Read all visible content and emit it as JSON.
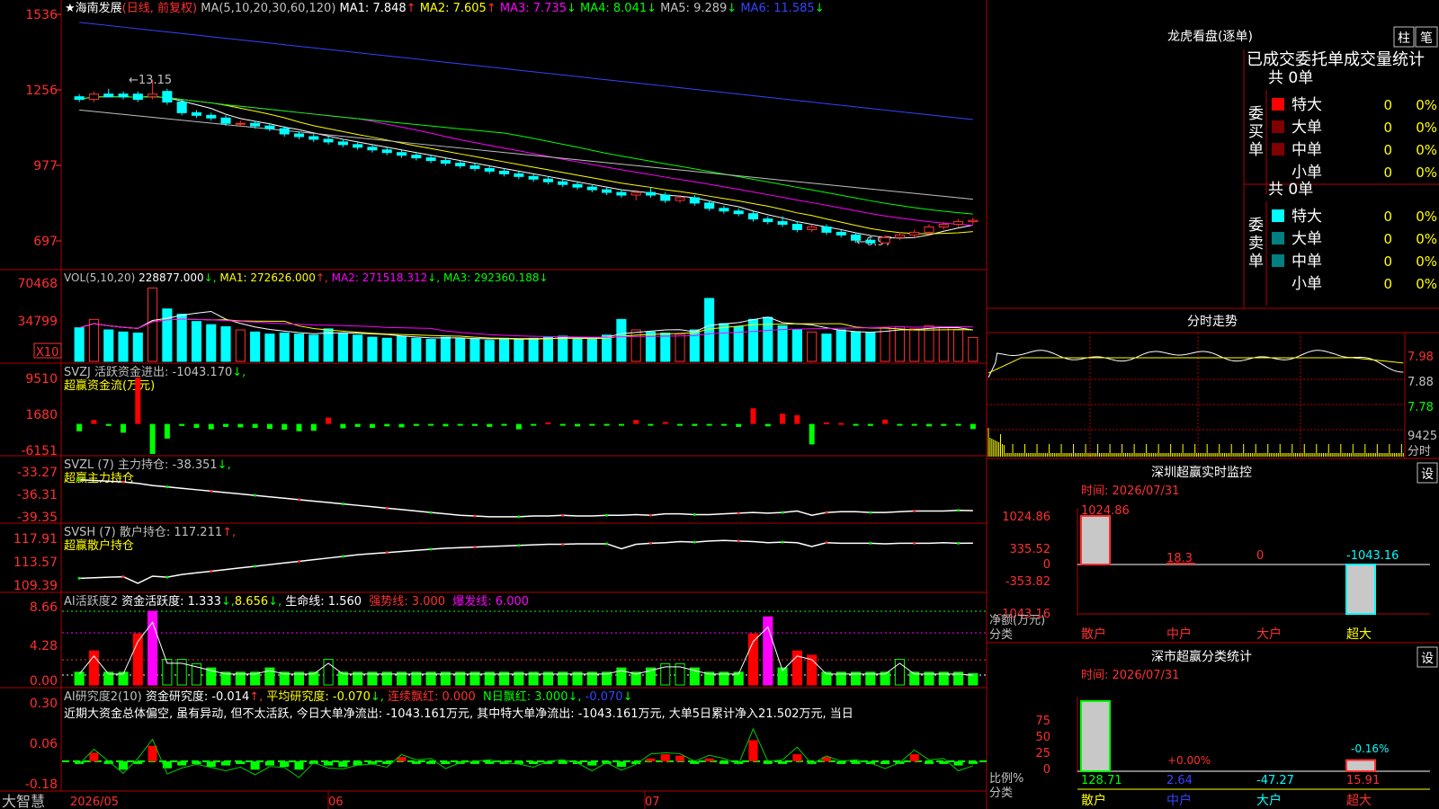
{
  "stock": {
    "name": "海南发展",
    "mode": "(日线, 前复权)",
    "ma_spec": "MA(5,10,20,30,60,120)",
    "ma": [
      {
        "label": "MA1: 7.848",
        "arrow": "↑",
        "color": "#ffffff"
      },
      {
        "label": "MA2: 7.605",
        "arrow": "↑",
        "color": "#ffff00"
      },
      {
        "label": "MA3: 7.735",
        "arrow": "↓",
        "color": "#ff00ff"
      },
      {
        "label": "MA4: 8.041",
        "arrow": "↓",
        "color": "#00ff00"
      },
      {
        "label": "MA5: 9.289",
        "arrow": "↓",
        "color": "#c0c0c0"
      },
      {
        "label": "MA6: 11.585",
        "arrow": "↓",
        "color": "#3344ff"
      }
    ],
    "price_axis": [
      "1536",
      "1256",
      "977",
      "697"
    ],
    "high_label": "13.15",
    "low_label": "6.97"
  },
  "vol": {
    "spec": "VOL(5,10,20)",
    "value": "228877.000",
    "ma1": "MA1: 272626.000",
    "ma2": "MA2: 271518.312",
    "ma3": "MA3: 292360.188",
    "axis": [
      "70468",
      "34799"
    ],
    "unit": "X10"
  },
  "svzj": {
    "line1": "SVZJ  活跃资金进出: -1043.170",
    "line2": "超赢资金流(万元)",
    "axis": [
      "9510",
      "1680",
      "-6151"
    ]
  },
  "svzl": {
    "line1": "SVZL (7) 主力持仓: -38.351",
    "line2": "超赢主力持仓",
    "axis": [
      "-33.27",
      "-36.31",
      "-39.35"
    ]
  },
  "svsh": {
    "line1": "SVSH (7) 散户持仓: 117.211",
    "line2": "超赢散户持仓",
    "axis": [
      "117.91",
      "113.57",
      "109.39"
    ]
  },
  "ai_active": {
    "title": "AI活跃度2",
    "v1": "资金活跃度: 1.333",
    "v2": "8.656",
    "v3": "生命线: 1.560",
    "v4": "强势线: 3.000",
    "v5": "爆发线: 6.000",
    "axis": [
      "8.66",
      "4.28",
      "0.00"
    ]
  },
  "ai_research": {
    "title": "AI研究度2(10)",
    "v1": "资金研究度: -0.014",
    "v2": "平均研究度: -0.070",
    "v3": "连续飘红: 0.000",
    "v4": "N日飘红: 3.000",
    "v5": "-0.070",
    "summary": "近期大资金总体偏空, 虽有异动, 但不太活跃, 今日大单净流出: -1043.161万元, 其中特大单净流出: -1043.161万元, 大单5日累计净入21.502万元, 当日",
    "axis": [
      "0.30",
      "0.06",
      "-0.18"
    ]
  },
  "bottom": {
    "brand": "大智慧",
    "dates": [
      "2026/05",
      "06",
      "07"
    ]
  },
  "lhkp": {
    "title": "龙虎看盘(逐单)",
    "btn_zhu": "柱",
    "btn_bi": "笔",
    "header": "已成交委托单成交量统计",
    "buy_label": "委买单",
    "sell_label": "委卖单",
    "buy_total": "共 0单",
    "sell_total": "共 0单",
    "buy_rows": [
      {
        "name": "特大",
        "count": "0",
        "pct": "0%",
        "color": "#ff0000"
      },
      {
        "name": "大单",
        "count": "0",
        "pct": "0%",
        "color": "#800000"
      },
      {
        "name": "中单",
        "count": "0",
        "pct": "0%",
        "color": "#800000"
      },
      {
        "name": "小单",
        "count": "0",
        "pct": "0%",
        "color": ""
      }
    ],
    "sell_rows": [
      {
        "name": "特大",
        "count": "0",
        "pct": "0%",
        "color": "#00ffff"
      },
      {
        "name": "大单",
        "count": "0",
        "pct": "0%",
        "color": "#008080"
      },
      {
        "name": "中单",
        "count": "0",
        "pct": "0%",
        "color": "#008080"
      },
      {
        "name": "小单",
        "count": "0",
        "pct": "0%",
        "color": ""
      }
    ]
  },
  "intraday": {
    "title": "分时走势",
    "axis": [
      "7.98",
      "7.88",
      "7.78"
    ],
    "vol_label": "9425",
    "unit": "分时"
  },
  "sz_monitor": {
    "title": "深圳超赢实时监控",
    "btn": "设",
    "time": "时间: 2026/07/31",
    "axis": [
      "1024.86",
      "335.52",
      "0",
      "-353.82",
      "-1043.16"
    ],
    "values": [
      "1024.86",
      "18.3",
      "0",
      "-1043.16"
    ],
    "ylabel1": "净额(万元)",
    "ylabel2": "分类",
    "categories": [
      "散户",
      "中户",
      "大户",
      "超大"
    ]
  },
  "sz_class": {
    "title": "深市超赢分类统计",
    "btn": "设",
    "time": "时间: 2026/07/31",
    "axis": [
      "75",
      "50",
      "25",
      "0"
    ],
    "labels_top": [
      "+0.00%",
      "-0.16%"
    ],
    "values": [
      "128.71",
      "2.64",
      "-47.27",
      "15.91"
    ],
    "ylabel1": "比例%",
    "ylabel2": "分类",
    "categories": [
      "散户",
      "中户",
      "大户",
      "超大"
    ]
  },
  "chart_data": [
    {
      "type": "candlestick",
      "title": "海南发展 (日线, 前复权)",
      "x_labels": [
        "2026/05",
        "06",
        "07"
      ],
      "ylim": [
        6.5,
        15.6
      ],
      "candles": [
        [
          12.5,
          12.6,
          12.3,
          12.4
        ],
        [
          12.4,
          12.7,
          12.3,
          12.6
        ],
        [
          12.6,
          12.8,
          12.5,
          12.5
        ],
        [
          12.6,
          12.7,
          12.4,
          12.5
        ],
        [
          12.6,
          12.7,
          12.3,
          12.4
        ],
        [
          12.5,
          13.15,
          12.4,
          12.6
        ],
        [
          12.7,
          12.8,
          12.2,
          12.3
        ],
        [
          12.3,
          12.4,
          11.8,
          11.9
        ],
        [
          11.9,
          12.0,
          11.7,
          11.8
        ],
        [
          11.8,
          11.9,
          11.6,
          11.7
        ],
        [
          11.7,
          11.8,
          11.4,
          11.5
        ],
        [
          11.5,
          11.6,
          11.4,
          11.5
        ],
        [
          11.5,
          11.6,
          11.3,
          11.4
        ],
        [
          11.4,
          11.5,
          11.2,
          11.3
        ],
        [
          11.3,
          11.4,
          11.0,
          11.1
        ],
        [
          11.1,
          11.2,
          10.9,
          11.0
        ],
        [
          11.0,
          11.1,
          10.8,
          10.9
        ],
        [
          10.9,
          11.0,
          10.7,
          10.8
        ],
        [
          10.8,
          10.9,
          10.6,
          10.7
        ],
        [
          10.7,
          10.8,
          10.5,
          10.6
        ],
        [
          10.6,
          10.7,
          10.4,
          10.5
        ],
        [
          10.5,
          10.6,
          10.3,
          10.4
        ],
        [
          10.4,
          10.5,
          10.2,
          10.3
        ],
        [
          10.3,
          10.4,
          10.1,
          10.2
        ],
        [
          10.2,
          10.3,
          10.0,
          10.1
        ],
        [
          10.1,
          10.2,
          9.9,
          10.0
        ],
        [
          10.0,
          10.1,
          9.8,
          9.9
        ],
        [
          9.9,
          10.0,
          9.7,
          9.8
        ],
        [
          9.8,
          9.9,
          9.6,
          9.7
        ],
        [
          9.7,
          9.8,
          9.5,
          9.6
        ],
        [
          9.6,
          9.7,
          9.4,
          9.5
        ],
        [
          9.5,
          9.6,
          9.3,
          9.4
        ],
        [
          9.4,
          9.5,
          9.2,
          9.3
        ],
        [
          9.3,
          9.4,
          9.1,
          9.2
        ],
        [
          9.2,
          9.3,
          9.0,
          9.1
        ],
        [
          9.1,
          9.2,
          8.9,
          9.0
        ],
        [
          9.0,
          9.1,
          8.8,
          8.9
        ],
        [
          8.9,
          9.0,
          8.7,
          8.8
        ],
        [
          8.8,
          9.0,
          8.6,
          8.9
        ],
        [
          8.9,
          9.1,
          8.7,
          8.8
        ],
        [
          8.8,
          8.9,
          8.5,
          8.6
        ],
        [
          8.6,
          8.8,
          8.5,
          8.7
        ],
        [
          8.7,
          8.8,
          8.4,
          8.5
        ],
        [
          8.5,
          8.6,
          8.2,
          8.3
        ],
        [
          8.3,
          8.4,
          8.1,
          8.2
        ],
        [
          8.2,
          8.3,
          8.0,
          8.1
        ],
        [
          8.1,
          8.2,
          7.8,
          7.9
        ],
        [
          7.9,
          8.0,
          7.7,
          7.8
        ],
        [
          7.8,
          8.0,
          7.6,
          7.7
        ],
        [
          7.7,
          7.8,
          7.4,
          7.5
        ],
        [
          7.5,
          7.7,
          7.4,
          7.6
        ],
        [
          7.6,
          7.7,
          7.3,
          7.4
        ],
        [
          7.4,
          7.5,
          7.2,
          7.3
        ],
        [
          7.3,
          7.4,
          7.0,
          7.1
        ],
        [
          7.1,
          7.2,
          6.97,
          7.0
        ],
        [
          7.0,
          7.3,
          6.98,
          7.2
        ],
        [
          7.2,
          7.4,
          7.1,
          7.3
        ],
        [
          7.3,
          7.5,
          7.2,
          7.4
        ],
        [
          7.4,
          7.7,
          7.3,
          7.6
        ],
        [
          7.6,
          7.8,
          7.5,
          7.7
        ],
        [
          7.7,
          7.9,
          7.6,
          7.8
        ],
        [
          7.8,
          7.95,
          7.7,
          7.85
        ]
      ]
    },
    {
      "type": "bar",
      "title": "VOL(5,10,20)",
      "values": [
        32000,
        40000,
        30000,
        28000,
        27000,
        70000,
        50000,
        45000,
        38000,
        35000,
        33000,
        30000,
        28000,
        26000,
        27000,
        26000,
        25000,
        31000,
        27000,
        25000,
        23000,
        22000,
        24000,
        22000,
        21000,
        23000,
        22000,
        21000,
        20000,
        22000,
        21000,
        22000,
        23000,
        24000,
        22000,
        21000,
        25000,
        40000,
        30000,
        28000,
        27000,
        26000,
        30000,
        60000,
        36000,
        33000,
        40000,
        42000,
        34000,
        30000,
        28000,
        26000,
        30000,
        28000,
        27000,
        32000,
        33000,
        31000,
        34000,
        32000,
        30000,
        22800
      ]
    },
    {
      "type": "bar",
      "title": "SVZJ 活跃资金进出",
      "values": [
        -1500,
        800,
        -400,
        -1800,
        9510,
        -6151,
        -3000,
        -400,
        -800,
        -1100,
        -600,
        -700,
        -800,
        -1000,
        -1200,
        -1500,
        -1400,
        1300,
        -900,
        -600,
        -800,
        -500,
        -700,
        -400,
        -300,
        -500,
        -200,
        -400,
        -600,
        -300,
        -1100,
        -200,
        300,
        -300,
        -500,
        -200,
        -300,
        -100,
        800,
        -200,
        400,
        -300,
        -400,
        -200,
        -100,
        -600,
        3200,
        -500,
        2100,
        1800,
        -4200,
        300,
        200,
        -300,
        -400,
        900,
        -200,
        -300,
        -500,
        -400,
        -300,
        -1043
      ]
    },
    {
      "type": "line",
      "title": "SVZL (7) 主力持仓",
      "ylim": [
        -39.35,
        -33.27
      ],
      "values": [
        -34.0,
        -34.1,
        -34.2,
        -34.3,
        -34.5,
        -34.8,
        -35.0,
        -35.2,
        -35.4,
        -35.6,
        -35.8,
        -36.0,
        -36.2,
        -36.4,
        -36.6,
        -36.8,
        -37.0,
        -37.2,
        -37.4,
        -37.6,
        -37.8,
        -38.0,
        -38.2,
        -38.4,
        -38.6,
        -38.8,
        -39.0,
        -39.1,
        -39.2,
        -39.2,
        -39.2,
        -39.1,
        -39.1,
        -39.0,
        -39.1,
        -39.1,
        -39.0,
        -39.0,
        -38.9,
        -39.0,
        -38.8,
        -38.8,
        -38.9,
        -38.9,
        -38.8,
        -38.7,
        -38.6,
        -38.7,
        -38.6,
        -38.4,
        -39.0,
        -38.6,
        -38.5,
        -38.5,
        -38.6,
        -38.6,
        -38.5,
        -38.4,
        -38.4,
        -38.4,
        -38.3,
        -38.351
      ]
    },
    {
      "type": "line",
      "title": "SVSH (7) 散户持仓",
      "ylim": [
        109.39,
        117.91
      ],
      "values": [
        110.8,
        110.9,
        111.0,
        111.1,
        109.9,
        111.2,
        111.0,
        111.5,
        111.8,
        112.1,
        112.4,
        112.7,
        113.0,
        113.3,
        113.6,
        113.9,
        114.2,
        114.5,
        114.8,
        115.1,
        115.3,
        115.5,
        115.7,
        115.9,
        116.1,
        116.3,
        116.4,
        116.5,
        116.6,
        116.7,
        116.8,
        116.9,
        117.0,
        117.0,
        117.1,
        117.1,
        117.1,
        116.2,
        117.0,
        117.2,
        117.3,
        117.5,
        117.4,
        117.6,
        117.7,
        117.6,
        117.5,
        117.3,
        117.4,
        117.3,
        116.6,
        117.3,
        117.2,
        117.2,
        117.2,
        117.1,
        117.2,
        117.2,
        117.2,
        117.3,
        117.2,
        117.211
      ]
    },
    {
      "type": "bar",
      "title": "AI活跃度2",
      "ylim": [
        0,
        8.66
      ],
      "values": [
        1.5,
        4.0,
        1.5,
        1.5,
        6.0,
        8.66,
        3.0,
        3.0,
        2.5,
        2.0,
        1.5,
        1.5,
        1.5,
        2.0,
        1.5,
        1.5,
        1.5,
        3.0,
        1.5,
        1.5,
        1.5,
        1.5,
        1.5,
        1.5,
        1.5,
        1.5,
        1.5,
        1.5,
        1.5,
        1.5,
        1.5,
        1.5,
        1.5,
        1.5,
        1.5,
        1.5,
        1.5,
        2.0,
        1.5,
        2.0,
        2.5,
        2.5,
        2.0,
        1.5,
        1.5,
        1.5,
        6.0,
        8.0,
        2.0,
        4.0,
        3.5,
        1.5,
        1.5,
        1.5,
        1.5,
        1.5,
        3.0,
        1.5,
        1.5,
        1.5,
        1.5,
        1.333
      ]
    },
    {
      "type": "bar",
      "title": "AI研究度2(10)",
      "ylim": [
        -0.18,
        0.3
      ],
      "values": [
        0.0,
        0.06,
        0.0,
        -0.06,
        0.0,
        0.11,
        -0.05,
        -0.03,
        -0.02,
        -0.04,
        -0.03,
        -0.02,
        -0.06,
        -0.03,
        -0.04,
        -0.06,
        0.0,
        -0.03,
        -0.04,
        -0.03,
        0.0,
        -0.02,
        0.03,
        0.0,
        0.0,
        -0.02,
        0.0,
        0.0,
        0.0,
        -0.02,
        0.0,
        -0.02,
        0.0,
        0.0,
        -0.02,
        -0.03,
        0.0,
        -0.04,
        -0.02,
        0.02,
        0.05,
        0.04,
        0.0,
        0.02,
        0.0,
        0.0,
        0.15,
        0.0,
        0.0,
        0.05,
        0.0,
        0.03,
        0.0,
        0.0,
        -0.02,
        -0.02,
        0.0,
        0.05,
        0.0,
        0.0,
        -0.03,
        -0.014
      ]
    }
  ]
}
